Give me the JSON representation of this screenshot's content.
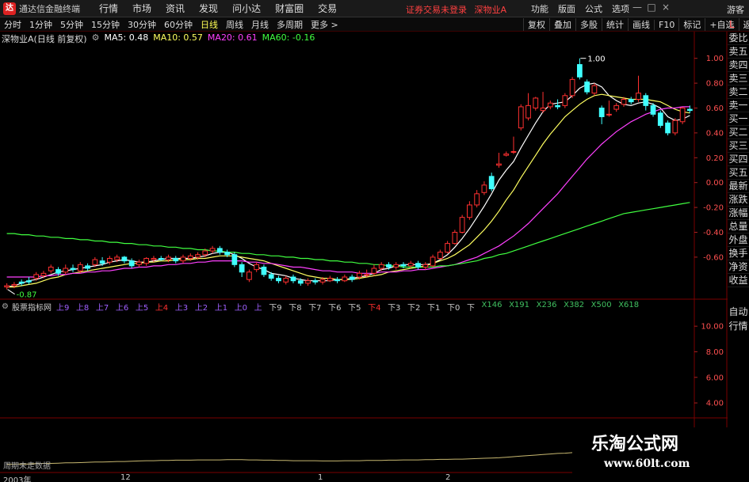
{
  "app": {
    "title": "通达信金融终端",
    "logo_glyph": "达",
    "menu": [
      "行情",
      "市场",
      "资讯",
      "发现",
      "问小达",
      "财富圈",
      "交易"
    ],
    "login_warning": "证券交易未登录",
    "stock_name_top": "深物业A",
    "right_menu": [
      "功能",
      "版面",
      "公式",
      "选项"
    ],
    "window_controls": [
      "—",
      "□",
      "×"
    ],
    "guest": "游客"
  },
  "toolbar": {
    "periods": [
      "分时",
      "1分钟",
      "5分钟",
      "15分钟",
      "30分钟",
      "60分钟",
      "日线",
      "周线",
      "月线",
      "多周期",
      "更多 >"
    ],
    "active_period": "日线",
    "right_buttons": [
      "复权",
      "叠加",
      "多股",
      "统计",
      "画线",
      "F10",
      "标记",
      "+自选",
      "返回"
    ]
  },
  "info": {
    "stock": "深物业A(日线 前复权)",
    "ma5": "MA5: 0.48",
    "ma10": "MA10: 0.57",
    "ma20": "MA20: 0.61",
    "ma60": "MA60: -0.16"
  },
  "colors": {
    "up": "#ff3030",
    "down": "#40ffff",
    "ma5": "#ffffff",
    "ma10": "#ffff60",
    "ma20": "#ff40ff",
    "ma60": "#40ff40",
    "grid": "#5a0000"
  },
  "side_panel": {
    "top_label": "L",
    "items": [
      "委比",
      "卖五",
      "卖四",
      "卖三",
      "卖二",
      "卖一",
      "买一",
      "买二",
      "买三",
      "买四",
      "买五",
      "最新",
      "涨跌",
      "涨幅",
      "总量",
      "外盘",
      "换手",
      "净资",
      "收益"
    ],
    "items2": [
      "自动",
      "行情"
    ]
  },
  "main_axis": {
    "ticks": [
      "1.00",
      "0.80",
      "0.60",
      "0.40",
      "0.20",
      "0.00",
      "-0.20",
      "-0.40",
      "-0.60"
    ],
    "max_label": "1.00",
    "min_label": "-0.87"
  },
  "indicator": {
    "title": "股票指标网",
    "items": [
      {
        "t": "上9",
        "c": "#a060ff"
      },
      {
        "t": "上8",
        "c": "#a060ff"
      },
      {
        "t": "上7",
        "c": "#a060ff"
      },
      {
        "t": "上6",
        "c": "#a060ff"
      },
      {
        "t": "上5",
        "c": "#a060ff"
      },
      {
        "t": "上4",
        "c": "#ff3030"
      },
      {
        "t": "上3",
        "c": "#a060ff"
      },
      {
        "t": "上2",
        "c": "#a060ff"
      },
      {
        "t": "上1",
        "c": "#a060ff"
      },
      {
        "t": "上0",
        "c": "#a060ff"
      },
      {
        "t": "上",
        "c": "#a060ff"
      },
      {
        "t": "下9",
        "c": "#cccccc"
      },
      {
        "t": "下8",
        "c": "#cccccc"
      },
      {
        "t": "下7",
        "c": "#cccccc"
      },
      {
        "t": "下6",
        "c": "#cccccc"
      },
      {
        "t": "下5",
        "c": "#cccccc"
      },
      {
        "t": "下4",
        "c": "#ff3030"
      },
      {
        "t": "下3",
        "c": "#cccccc"
      },
      {
        "t": "下2",
        "c": "#cccccc"
      },
      {
        "t": "下1",
        "c": "#cccccc"
      },
      {
        "t": "下0",
        "c": "#cccccc"
      },
      {
        "t": "下",
        "c": "#cccccc"
      },
      {
        "t": "X146",
        "c": "#40c060"
      },
      {
        "t": "X191",
        "c": "#40c060"
      },
      {
        "t": "X236",
        "c": "#40c060"
      },
      {
        "t": "X382",
        "c": "#40c060"
      },
      {
        "t": "X500",
        "c": "#40c060"
      },
      {
        "t": "X618",
        "c": "#40c060"
      }
    ],
    "axis_ticks": [
      "10.00",
      "8.00",
      "6.00",
      "4.00"
    ]
  },
  "no_data": "周期未走数据",
  "date_axis": [
    "2003年",
    "12",
    "1",
    "2"
  ],
  "watermark": {
    "title": "乐淘公式网",
    "url": "www.60lt.com"
  },
  "chart_data": {
    "type": "candlestick",
    "ylim": [
      -0.9,
      1.1
    ],
    "candles": [
      [
        -0.84,
        -0.83,
        -0.81,
        -0.86
      ],
      [
        -0.83,
        -0.82,
        -0.8,
        -0.85
      ],
      [
        -0.8,
        -0.81,
        -0.78,
        -0.83
      ],
      [
        -0.79,
        -0.8,
        -0.76,
        -0.82
      ],
      [
        -0.77,
        -0.74,
        -0.72,
        -0.79
      ],
      [
        -0.75,
        -0.73,
        -0.71,
        -0.77
      ],
      [
        -0.71,
        -0.68,
        -0.66,
        -0.73
      ],
      [
        -0.7,
        -0.73,
        -0.68,
        -0.75
      ],
      [
        -0.72,
        -0.69,
        -0.66,
        -0.74
      ],
      [
        -0.69,
        -0.7,
        -0.66,
        -0.72
      ],
      [
        -0.71,
        -0.66,
        -0.64,
        -0.73
      ],
      [
        -0.67,
        -0.69,
        -0.65,
        -0.71
      ],
      [
        -0.66,
        -0.62,
        -0.6,
        -0.68
      ],
      [
        -0.63,
        -0.65,
        -0.6,
        -0.67
      ],
      [
        -0.64,
        -0.61,
        -0.59,
        -0.66
      ],
      [
        -0.62,
        -0.6,
        -0.58,
        -0.64
      ],
      [
        -0.6,
        -0.63,
        -0.59,
        -0.65
      ],
      [
        -0.63,
        -0.67,
        -0.61,
        -0.69
      ],
      [
        -0.66,
        -0.64,
        -0.62,
        -0.68
      ],
      [
        -0.65,
        -0.61,
        -0.6,
        -0.67
      ],
      [
        -0.62,
        -0.61,
        -0.59,
        -0.64
      ],
      [
        -0.61,
        -0.62,
        -0.59,
        -0.63
      ],
      [
        -0.62,
        -0.6,
        -0.58,
        -0.64
      ],
      [
        -0.61,
        -0.63,
        -0.59,
        -0.65
      ],
      [
        -0.63,
        -0.6,
        -0.58,
        -0.65
      ],
      [
        -0.61,
        -0.59,
        -0.57,
        -0.63
      ],
      [
        -0.6,
        -0.58,
        -0.56,
        -0.62
      ],
      [
        -0.58,
        -0.55,
        -0.53,
        -0.6
      ],
      [
        -0.55,
        -0.53,
        -0.51,
        -0.57
      ],
      [
        -0.53,
        -0.56,
        -0.51,
        -0.58
      ],
      [
        -0.56,
        -0.58,
        -0.54,
        -0.6
      ],
      [
        -0.58,
        -0.66,
        -0.56,
        -0.68
      ],
      [
        -0.66,
        -0.72,
        -0.64,
        -0.76
      ],
      [
        -0.78,
        -0.72,
        -0.7,
        -0.8
      ],
      [
        -0.7,
        -0.66,
        -0.64,
        -0.72
      ],
      [
        -0.68,
        -0.74,
        -0.66,
        -0.76
      ],
      [
        -0.74,
        -0.77,
        -0.72,
        -0.79
      ],
      [
        -0.77,
        -0.79,
        -0.75,
        -0.81
      ],
      [
        -0.8,
        -0.77,
        -0.75,
        -0.82
      ],
      [
        -0.76,
        -0.79,
        -0.74,
        -0.81
      ],
      [
        -0.79,
        -0.81,
        -0.77,
        -0.83
      ],
      [
        -0.81,
        -0.79,
        -0.77,
        -0.83
      ],
      [
        -0.79,
        -0.8,
        -0.77,
        -0.82
      ],
      [
        -0.8,
        -0.78,
        -0.76,
        -0.82
      ],
      [
        -0.79,
        -0.77,
        -0.75,
        -0.8
      ],
      [
        -0.78,
        -0.79,
        -0.76,
        -0.81
      ],
      [
        -0.79,
        -0.76,
        -0.74,
        -0.8
      ],
      [
        -0.76,
        -0.78,
        -0.74,
        -0.8
      ],
      [
        -0.76,
        -0.73,
        -0.71,
        -0.78
      ],
      [
        -0.74,
        -0.74,
        -0.7,
        -0.76
      ],
      [
        -0.73,
        -0.69,
        -0.66,
        -0.75
      ],
      [
        -0.69,
        -0.66,
        -0.64,
        -0.71
      ],
      [
        -0.66,
        -0.68,
        -0.64,
        -0.7
      ],
      [
        -0.68,
        -0.66,
        -0.64,
        -0.7
      ],
      [
        -0.66,
        -0.67,
        -0.64,
        -0.69
      ],
      [
        -0.67,
        -0.65,
        -0.63,
        -0.69
      ],
      [
        -0.65,
        -0.68,
        -0.63,
        -0.7
      ],
      [
        -0.68,
        -0.66,
        -0.64,
        -0.7
      ],
      [
        -0.67,
        -0.6,
        -0.58,
        -0.68
      ],
      [
        -0.61,
        -0.56,
        -0.54,
        -0.62
      ],
      [
        -0.56,
        -0.49,
        -0.47,
        -0.57
      ],
      [
        -0.49,
        -0.4,
        -0.38,
        -0.5
      ],
      [
        -0.4,
        -0.28,
        -0.26,
        -0.41
      ],
      [
        -0.28,
        -0.18,
        -0.15,
        -0.3
      ],
      [
        -0.18,
        -0.09,
        -0.06,
        -0.2
      ],
      [
        -0.08,
        -0.02,
        0.01,
        -0.1
      ],
      [
        0.05,
        -0.05,
        0.08,
        -0.07
      ],
      [
        0.14,
        0.15,
        0.24,
        0.12
      ],
      [
        0.22,
        0.23,
        0.25,
        0.21
      ],
      [
        0.25,
        0.25,
        0.37,
        0.23
      ],
      [
        0.44,
        0.61,
        0.63,
        0.42
      ],
      [
        0.52,
        0.62,
        0.72,
        0.5
      ],
      [
        0.6,
        0.68,
        0.69,
        0.58
      ],
      [
        0.58,
        0.6,
        0.73,
        0.56
      ],
      [
        0.61,
        0.64,
        0.66,
        0.59
      ],
      [
        0.62,
        0.61,
        0.67,
        0.59
      ],
      [
        0.62,
        0.7,
        0.72,
        0.6
      ],
      [
        0.7,
        0.83,
        0.85,
        0.68
      ],
      [
        0.95,
        0.85,
        1.0,
        0.83
      ],
      [
        0.81,
        0.73,
        0.83,
        0.71
      ],
      [
        0.72,
        0.78,
        0.8,
        0.7
      ],
      [
        0.6,
        0.53,
        0.62,
        0.47
      ],
      [
        0.55,
        0.55,
        0.66,
        0.53
      ],
      [
        0.59,
        0.62,
        0.64,
        0.57
      ],
      [
        0.63,
        0.67,
        0.69,
        0.61
      ],
      [
        0.67,
        0.65,
        0.69,
        0.63
      ],
      [
        0.67,
        0.72,
        0.86,
        0.65
      ],
      [
        0.7,
        0.62,
        0.72,
        0.58
      ],
      [
        0.62,
        0.55,
        0.64,
        0.53
      ],
      [
        0.56,
        0.46,
        0.58,
        0.44
      ],
      [
        0.48,
        0.4,
        0.5,
        0.38
      ],
      [
        0.4,
        0.5,
        0.52,
        0.38
      ],
      [
        0.49,
        0.6,
        0.61,
        0.47
      ],
      [
        0.59,
        0.58,
        0.62,
        0.56
      ]
    ],
    "series": [
      {
        "name": "MA5",
        "values": [
          -0.84,
          -0.83,
          -0.81,
          -0.79,
          -0.78,
          -0.76,
          -0.74,
          -0.72,
          -0.71,
          -0.7,
          -0.69,
          -0.68,
          -0.67,
          -0.66,
          -0.64,
          -0.63,
          -0.62,
          -0.63,
          -0.64,
          -0.64,
          -0.63,
          -0.62,
          -0.61,
          -0.61,
          -0.61,
          -0.61,
          -0.6,
          -0.59,
          -0.57,
          -0.56,
          -0.56,
          -0.58,
          -0.61,
          -0.65,
          -0.68,
          -0.7,
          -0.73,
          -0.74,
          -0.75,
          -0.77,
          -0.78,
          -0.79,
          -0.79,
          -0.79,
          -0.79,
          -0.78,
          -0.78,
          -0.77,
          -0.76,
          -0.75,
          -0.73,
          -0.7,
          -0.69,
          -0.67,
          -0.66,
          -0.66,
          -0.66,
          -0.66,
          -0.65,
          -0.62,
          -0.58,
          -0.52,
          -0.45,
          -0.37,
          -0.28,
          -0.19,
          -0.09,
          0.02,
          0.1,
          0.17,
          0.28,
          0.38,
          0.48,
          0.57,
          0.63,
          0.64,
          0.65,
          0.7,
          0.76,
          0.79,
          0.8,
          0.77,
          0.7,
          0.66,
          0.63,
          0.62,
          0.64,
          0.65,
          0.63,
          0.6,
          0.53,
          0.5,
          0.51,
          0.54
        ]
      },
      {
        "name": "MA10",
        "values": [
          -0.84,
          -0.84,
          -0.83,
          -0.82,
          -0.81,
          -0.79,
          -0.77,
          -0.76,
          -0.74,
          -0.73,
          -0.72,
          -0.71,
          -0.7,
          -0.69,
          -0.68,
          -0.67,
          -0.66,
          -0.65,
          -0.65,
          -0.64,
          -0.64,
          -0.63,
          -0.63,
          -0.62,
          -0.62,
          -0.62,
          -0.61,
          -0.61,
          -0.6,
          -0.59,
          -0.59,
          -0.59,
          -0.6,
          -0.61,
          -0.62,
          -0.63,
          -0.65,
          -0.67,
          -0.69,
          -0.71,
          -0.73,
          -0.75,
          -0.76,
          -0.77,
          -0.77,
          -0.78,
          -0.78,
          -0.78,
          -0.77,
          -0.76,
          -0.75,
          -0.74,
          -0.72,
          -0.71,
          -0.7,
          -0.69,
          -0.68,
          -0.67,
          -0.65,
          -0.63,
          -0.61,
          -0.58,
          -0.54,
          -0.5,
          -0.44,
          -0.38,
          -0.31,
          -0.23,
          -0.14,
          -0.06,
          0.04,
          0.13,
          0.22,
          0.31,
          0.39,
          0.46,
          0.53,
          0.58,
          0.63,
          0.67,
          0.7,
          0.71,
          0.7,
          0.69,
          0.68,
          0.67,
          0.67,
          0.67,
          0.66,
          0.65,
          0.62,
          0.59,
          0.57,
          0.56
        ]
      },
      {
        "name": "MA20",
        "values": [
          -0.76,
          -0.76,
          -0.76,
          -0.76,
          -0.76,
          -0.75,
          -0.75,
          -0.74,
          -0.74,
          -0.73,
          -0.73,
          -0.72,
          -0.72,
          -0.71,
          -0.71,
          -0.7,
          -0.69,
          -0.69,
          -0.68,
          -0.68,
          -0.67,
          -0.67,
          -0.66,
          -0.66,
          -0.65,
          -0.65,
          -0.64,
          -0.64,
          -0.63,
          -0.63,
          -0.63,
          -0.63,
          -0.63,
          -0.64,
          -0.64,
          -0.65,
          -0.65,
          -0.66,
          -0.67,
          -0.68,
          -0.68,
          -0.69,
          -0.7,
          -0.71,
          -0.71,
          -0.72,
          -0.72,
          -0.72,
          -0.73,
          -0.73,
          -0.73,
          -0.72,
          -0.72,
          -0.72,
          -0.71,
          -0.71,
          -0.7,
          -0.7,
          -0.69,
          -0.68,
          -0.67,
          -0.66,
          -0.64,
          -0.62,
          -0.6,
          -0.57,
          -0.54,
          -0.51,
          -0.47,
          -0.43,
          -0.38,
          -0.33,
          -0.27,
          -0.21,
          -0.15,
          -0.09,
          -0.02,
          0.05,
          0.12,
          0.19,
          0.25,
          0.31,
          0.36,
          0.41,
          0.45,
          0.49,
          0.52,
          0.55,
          0.57,
          0.59,
          0.6,
          0.6,
          0.61,
          0.61
        ]
      },
      {
        "name": "MA60",
        "values": [
          -0.41,
          -0.41,
          -0.42,
          -0.42,
          -0.43,
          -0.43,
          -0.44,
          -0.44,
          -0.45,
          -0.45,
          -0.46,
          -0.46,
          -0.47,
          -0.47,
          -0.48,
          -0.48,
          -0.49,
          -0.49,
          -0.5,
          -0.5,
          -0.51,
          -0.51,
          -0.52,
          -0.52,
          -0.53,
          -0.53,
          -0.54,
          -0.54,
          -0.55,
          -0.55,
          -0.56,
          -0.56,
          -0.57,
          -0.57,
          -0.58,
          -0.58,
          -0.59,
          -0.59,
          -0.6,
          -0.6,
          -0.61,
          -0.61,
          -0.62,
          -0.62,
          -0.63,
          -0.63,
          -0.64,
          -0.64,
          -0.65,
          -0.65,
          -0.66,
          -0.66,
          -0.67,
          -0.67,
          -0.68,
          -0.68,
          -0.68,
          -0.68,
          -0.68,
          -0.67,
          -0.67,
          -0.66,
          -0.65,
          -0.64,
          -0.63,
          -0.61,
          -0.6,
          -0.58,
          -0.57,
          -0.55,
          -0.53,
          -0.51,
          -0.49,
          -0.47,
          -0.45,
          -0.43,
          -0.41,
          -0.39,
          -0.37,
          -0.35,
          -0.33,
          -0.31,
          -0.29,
          -0.27,
          -0.25,
          -0.24,
          -0.23,
          -0.22,
          -0.21,
          -0.2,
          -0.19,
          -0.18,
          -0.17,
          -0.16
        ]
      }
    ],
    "bottom_line": [
      0.21,
      0.22,
      0.23,
      0.23,
      0.24,
      0.25,
      0.25,
      0.26,
      0.27,
      0.27,
      0.28,
      0.29,
      0.3,
      0.3,
      0.31,
      0.32,
      0.32,
      0.33,
      0.34,
      0.35,
      0.35,
      0.36,
      0.36,
      0.37,
      0.37,
      0.37,
      0.38,
      0.38,
      0.38,
      0.38,
      0.39,
      0.39,
      0.39,
      0.38,
      0.38,
      0.37,
      0.37,
      0.36,
      0.36,
      0.35,
      0.35,
      0.35,
      0.35,
      0.34,
      0.34,
      0.34,
      0.35,
      0.35,
      0.35,
      0.36,
      0.36,
      0.36,
      0.37,
      0.37,
      0.38,
      0.38,
      0.38,
      0.39,
      0.39,
      0.4,
      0.4,
      0.41,
      0.41,
      0.42,
      0.43,
      0.44,
      0.45,
      0.46,
      0.48,
      0.5,
      0.52,
      0.54,
      0.56,
      0.58,
      0.6,
      0.62,
      0.63,
      0.65,
      0.66,
      0.67,
      0.69,
      0.71,
      0.73,
      0.75,
      0.77,
      0.79,
      0.81,
      0.83,
      0.85,
      0.87,
      0.88,
      0.89,
      0.9,
      0.91
    ]
  }
}
